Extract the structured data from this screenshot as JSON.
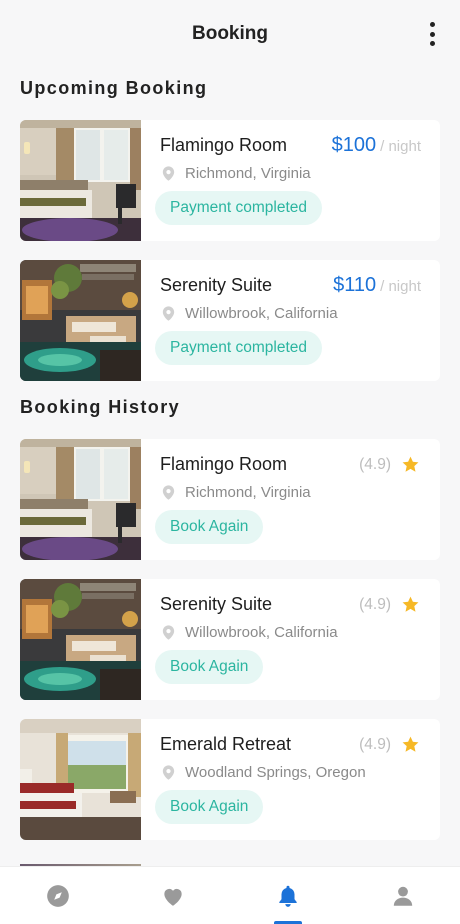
{
  "header": {
    "title": "Booking"
  },
  "upcoming": {
    "title": "Upcoming Booking",
    "items": [
      {
        "name": "Flamingo Room",
        "location": "Richmond, Virginia",
        "price": "$100",
        "per": "/ night",
        "status": "Payment completed"
      },
      {
        "name": "Serenity Suite",
        "location": "Willowbrook, California",
        "price": "$110",
        "per": "/ night",
        "status": "Payment completed"
      }
    ]
  },
  "history": {
    "title": "Booking History",
    "items": [
      {
        "name": "Flamingo Room",
        "location": "Richmond, Virginia",
        "rating": "(4.9)",
        "action": "Book Again"
      },
      {
        "name": "Serenity Suite",
        "location": "Willowbrook, California",
        "rating": "(4.9)",
        "action": "Book Again"
      },
      {
        "name": "Emerald Retreat",
        "location": "Woodland Springs, Oregon",
        "rating": "(4.9)",
        "action": "Book Again"
      }
    ]
  },
  "nav": {
    "items": [
      "compass-icon",
      "heart-icon",
      "bell-icon",
      "profile-icon"
    ],
    "active": "bell-icon"
  },
  "colors": {
    "accent": "#1c72d8",
    "badge_bg": "#e6f7f4",
    "badge_text": "#2bb5a0",
    "star": "#f6b826"
  }
}
